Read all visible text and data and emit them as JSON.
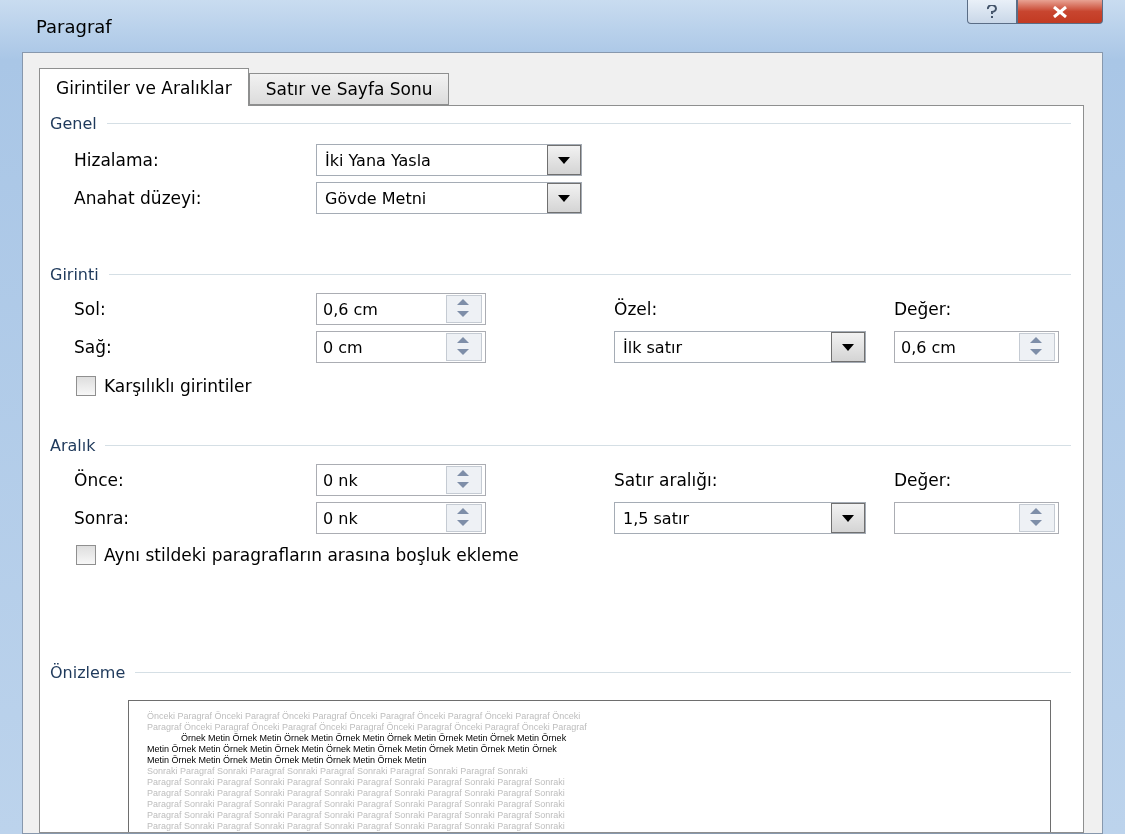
{
  "window": {
    "title": "Paragraf"
  },
  "tabs": [
    {
      "label": "Girintiler ve Aralıklar",
      "selected": true
    },
    {
      "label": "Satır ve Sayfa Sonu",
      "selected": false
    }
  ],
  "general": {
    "title": "Genel",
    "fields": [
      {
        "label": "Hizalama:",
        "value": "İki Yana Yasla"
      },
      {
        "label": "Anahat düzeyi:",
        "value": "Gövde Metni"
      }
    ]
  },
  "indent": {
    "title": "Girinti",
    "left": {
      "label": "Sol:",
      "value": "0,6 cm"
    },
    "right": {
      "label": "Sağ:",
      "value": "0 cm"
    },
    "special": {
      "label": "Özel:",
      "value": "İlk satır"
    },
    "by": {
      "label": "Değer:",
      "value": "0,6 cm"
    },
    "mirror": {
      "label": "Karşılıklı girintiler",
      "checked": false
    }
  },
  "spacing": {
    "title": "Aralık",
    "before": {
      "label": "Önce:",
      "value": "0 nk"
    },
    "after": {
      "label": "Sonra:",
      "value": "0 nk"
    },
    "line_spacing": {
      "label": "Satır aralığı:",
      "value": "1,5 satır"
    },
    "at": {
      "label": "Değer:"
    },
    "dont_add": {
      "label": "Aynı stildeki paragrafların arasına boşluk ekleme",
      "checked": false
    }
  },
  "preview": {
    "title": "Önizleme",
    "lines": [
      {
        "kind": "previous",
        "text": "Önceki Paragraf Önceki Paragraf Önceki Paragraf Önceki Paragraf Önceki Paragraf Önceki Paragraf Önceki"
      },
      {
        "kind": "previous",
        "text": "Paragraf Önceki Paragraf Önceki Paragraf Önceki Paragraf Önceki Paragraf Önceki Paragraf Önceki Paragraf"
      },
      {
        "kind": "sample-first",
        "text": "Örnek Metin Örnek Metin Örnek Metin Örnek Metin Örnek Metin Örnek Metin Örnek Metin Örnek"
      },
      {
        "kind": "sample",
        "text": "Metin Örnek Metin Örnek Metin Örnek Metin Örnek Metin Örnek Metin Örnek Metin Örnek Metin Örnek"
      },
      {
        "kind": "sample",
        "text": "Metin Örnek Metin Örnek Metin Örnek Metin Örnek Metin Örnek Metin"
      },
      {
        "kind": "next",
        "text": "Sonraki Paragraf Sonraki Paragraf Sonraki Paragraf Sonraki Paragraf Sonraki Paragraf Sonraki"
      },
      {
        "kind": "next",
        "text": "Paragraf Sonraki Paragraf Sonraki Paragraf Sonraki Paragraf Sonraki Paragraf Sonraki Paragraf Sonraki"
      },
      {
        "kind": "next",
        "text": "Paragraf Sonraki Paragraf Sonraki Paragraf Sonraki Paragraf Sonraki Paragraf Sonraki Paragraf Sonraki"
      },
      {
        "kind": "next",
        "text": "Paragraf Sonraki Paragraf Sonraki Paragraf Sonraki Paragraf Sonraki Paragraf Sonraki Paragraf Sonraki"
      },
      {
        "kind": "next",
        "text": "Paragraf Sonraki Paragraf Sonraki Paragraf Sonraki Paragraf Sonraki Paragraf Sonraki Paragraf Sonraki"
      },
      {
        "kind": "next",
        "text": "Paragraf Sonraki Paragraf Sonraki Paragraf Sonraki Paragraf Sonraki Paragraf Sonraki Paragraf Sonraki"
      }
    ]
  }
}
